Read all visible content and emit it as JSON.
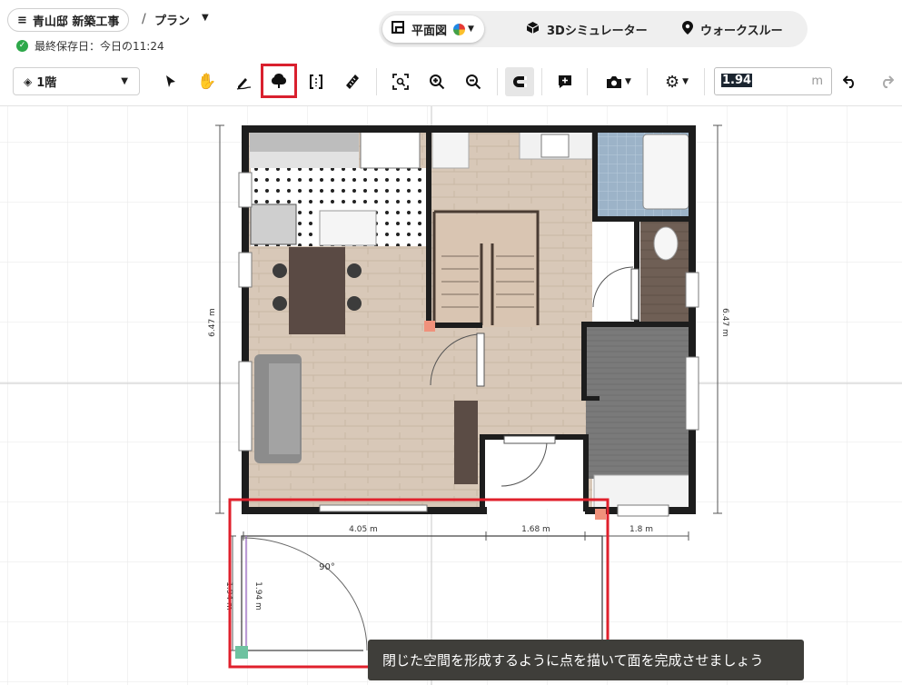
{
  "header": {
    "menu_icon": "hamburger-icon",
    "project_name": "青山邸 新築工事",
    "breadcrumb_separator": "/",
    "plan_name": "プラン",
    "last_saved": "最終保存日：今日の11:24"
  },
  "view_modes": [
    {
      "label": "平面図",
      "icon": "floorplan-icon",
      "active": true
    },
    {
      "label": "3Dシミュレーター",
      "icon": "cube-icon",
      "active": false
    },
    {
      "label": "ウォークスルー",
      "icon": "location-pin-icon",
      "active": false
    }
  ],
  "toolbar": {
    "floor_select": "1階",
    "length_input_value": "1.94",
    "length_unit": "m",
    "tools": [
      "select-arrow",
      "pan-hand",
      "draw-pen",
      "surface-tree",
      "bracket-room",
      "ruler",
      "zoom-fit",
      "zoom-in",
      "zoom-out",
      "magnet-snap",
      "comment-add",
      "camera",
      "settings",
      "undo",
      "redo"
    ],
    "selected_tool": "surface-tree"
  },
  "plan": {
    "dimensions": {
      "left_height": "6.47 m",
      "right_height": "6.47 m",
      "segment_1": "4.05 m",
      "segment_2": "1.68 m",
      "segment_3": "1.8 m",
      "draw_height_outer": "1.94 m",
      "draw_height_inner": "1.94 m",
      "angle": "90°"
    },
    "colors": {
      "wall": "#1d1d1d",
      "wood_floor": "#d8c7b6",
      "tile_floor": "#ffffff",
      "highlight": "#e0202c",
      "vertex_marker": "#f0917b",
      "start_marker": "#6ec2a0"
    }
  },
  "toast": {
    "message": "閉じた空間を形成するように点を描いて面を完成させましょう"
  }
}
